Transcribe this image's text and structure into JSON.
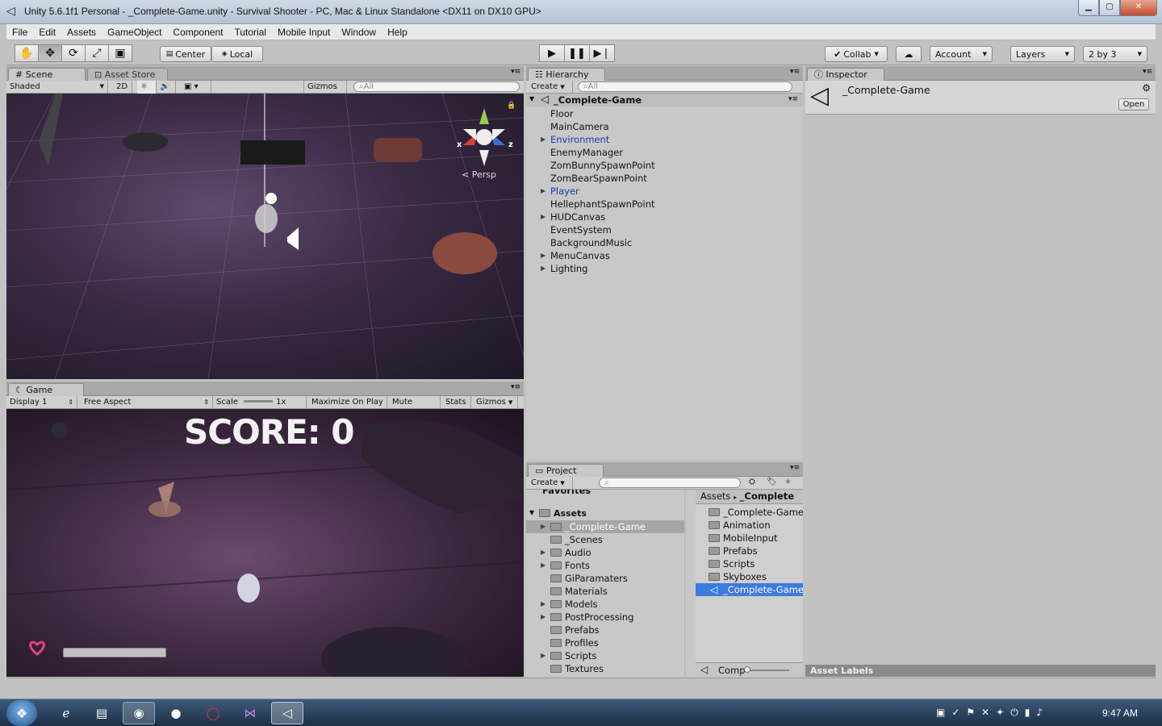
{
  "window": {
    "title": "Unity 5.6.1f1 Personal - _Complete-Game.unity - Survival Shooter - PC, Mac & Linux Standalone <DX11 on DX10 GPU>"
  },
  "menu": [
    "File",
    "Edit",
    "Assets",
    "GameObject",
    "Component",
    "Tutorial",
    "Mobile Input",
    "Window",
    "Help"
  ],
  "toolbar": {
    "pivot": "Center",
    "space": "Local",
    "collab": "Collab",
    "account": "Account",
    "layers": "Layers",
    "layout": "2 by 3"
  },
  "scene": {
    "tab": "Scene",
    "tab2": "Asset Store",
    "shading": "Shaded",
    "mode2d": "2D",
    "gizmos": "Gizmos",
    "search_placeholder": "All",
    "persp": "Persp",
    "axis_x": "x",
    "axis_z": "z"
  },
  "game": {
    "tab": "Game",
    "display": "Display 1",
    "aspect": "Free Aspect",
    "scale_label": "Scale",
    "scale_value": "1x",
    "maximize": "Maximize On Play",
    "mute": "Mute Audio",
    "stats": "Stats",
    "gizmos": "Gizmos",
    "score": "SCORE: 0"
  },
  "hierarchy": {
    "tab": "Hierarchy",
    "create": "Create",
    "search_placeholder": "All",
    "scene_name": "_Complete-Game",
    "items": [
      {
        "label": "Floor",
        "expandable": false,
        "prefab": false
      },
      {
        "label": "MainCamera",
        "expandable": false,
        "prefab": false
      },
      {
        "label": "Environment",
        "expandable": true,
        "prefab": true
      },
      {
        "label": "EnemyManager",
        "expandable": false,
        "prefab": false
      },
      {
        "label": "ZomBunnySpawnPoint",
        "expandable": false,
        "prefab": false
      },
      {
        "label": "ZomBearSpawnPoint",
        "expandable": false,
        "prefab": false
      },
      {
        "label": "Player",
        "expandable": true,
        "prefab": true
      },
      {
        "label": "HellephantSpawnPoint",
        "expandable": false,
        "prefab": false
      },
      {
        "label": "HUDCanvas",
        "expandable": true,
        "prefab": false
      },
      {
        "label": "EventSystem",
        "expandable": false,
        "prefab": false
      },
      {
        "label": "BackgroundMusic",
        "expandable": false,
        "prefab": false
      },
      {
        "label": "MenuCanvas",
        "expandable": true,
        "prefab": false
      },
      {
        "label": "Lighting",
        "expandable": true,
        "prefab": false
      }
    ]
  },
  "inspector": {
    "tab": "Inspector",
    "name": "_Complete-Game",
    "open": "Open",
    "asset_labels": "Asset Labels"
  },
  "project": {
    "tab": "Project",
    "create": "Create",
    "favorites": "Favorites",
    "assets_root": "Assets",
    "tree": [
      {
        "label": "_Complete-Game",
        "expandable": true,
        "selected": true
      },
      {
        "label": "_Scenes",
        "expandable": false,
        "selected": false
      },
      {
        "label": "Audio",
        "expandable": true,
        "selected": false
      },
      {
        "label": "Fonts",
        "expandable": true,
        "selected": false
      },
      {
        "label": "GiParamaters",
        "expandable": false,
        "selected": false
      },
      {
        "label": "Materials",
        "expandable": false,
        "selected": false
      },
      {
        "label": "Models",
        "expandable": true,
        "selected": false
      },
      {
        "label": "PostProcessing",
        "expandable": true,
        "selected": false
      },
      {
        "label": "Prefabs",
        "expandable": false,
        "selected": false
      },
      {
        "label": "Profiles",
        "expandable": false,
        "selected": false
      },
      {
        "label": "Scripts",
        "expandable": true,
        "selected": false
      },
      {
        "label": "Textures",
        "expandable": false,
        "selected": false
      }
    ],
    "breadcrumb": [
      "Assets",
      "_Complete"
    ],
    "files": [
      {
        "label": "_Complete-Game",
        "type": "folder",
        "selected": false
      },
      {
        "label": "Animation",
        "type": "folder",
        "selected": false
      },
      {
        "label": "MobileInput",
        "type": "folder",
        "selected": false
      },
      {
        "label": "Prefabs",
        "type": "folder",
        "selected": false
      },
      {
        "label": "Scripts",
        "type": "folder",
        "selected": false
      },
      {
        "label": "Skyboxes",
        "type": "folder",
        "selected": false
      },
      {
        "label": "_Complete-Game",
        "type": "scene",
        "selected": true
      }
    ],
    "footer_search": "Comp"
  },
  "taskbar": {
    "clock": "9:47 AM"
  }
}
